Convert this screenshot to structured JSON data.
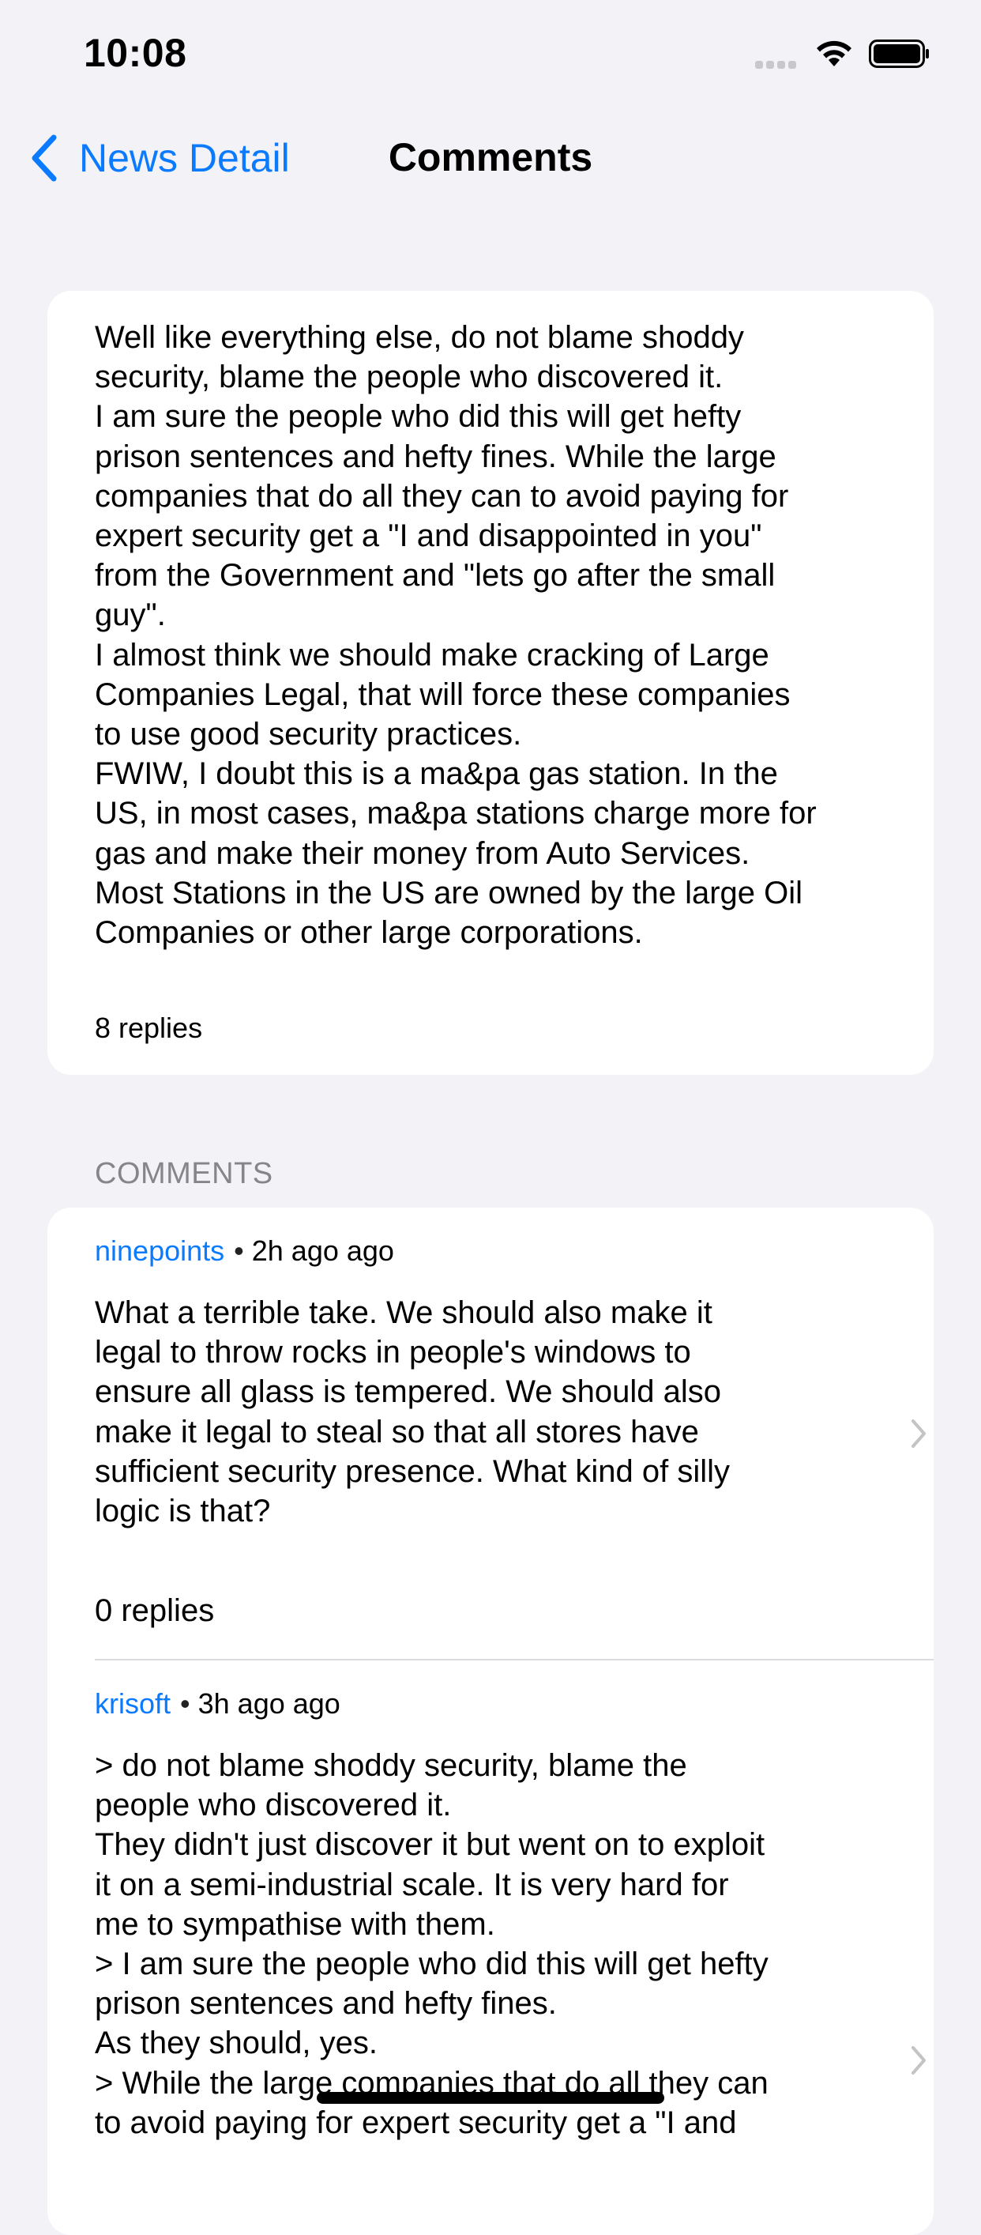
{
  "status_bar": {
    "time": "10:08"
  },
  "nav": {
    "back_label": "News Detail",
    "title": "Comments"
  },
  "main_comment": {
    "text": "Well like everything else, do not blame shoddy\nsecurity, blame the people who discovered it.\nI am sure the people who did this will get hefty\nprison sentences and hefty fines. While the large\ncompanies that do all they can to avoid paying for\nexpert security get a \"I and disappointed in you\"\nfrom the Government and \"lets go after the small\nguy\".\nI almost think we should make cracking of Large\nCompanies Legal, that will force these companies\nto use good security practices.\nFWIW, I doubt this is a ma&pa gas station. In the\nUS, in most cases, ma&pa stations charge more for\ngas and make their money from Auto Services.\nMost Stations in the US are owned by the large Oil\nCompanies or other large corporations.",
    "replies": "8 replies"
  },
  "section_header": "COMMENTS",
  "comments": [
    {
      "author": "ninepoints",
      "separator": "•",
      "time": "2h ago ago",
      "body": "What a terrible take. We should also make it\nlegal to throw rocks in people's windows to\nensure all glass is tempered. We should also\nmake it legal to steal so that all stores have\nsufficient security presence. What kind of silly\nlogic is that?",
      "replies": "0 replies"
    },
    {
      "author": "krisoft",
      "separator": "•",
      "time": "3h ago ago",
      "body": "> do not blame shoddy security, blame the\npeople who discovered it.\nThey didn't just discover it but went on to exploit\nit on a semi-industrial scale. It is very hard for\nme to sympathise with them.\n> I am sure the people who did this will get hefty\nprison sentences and hefty fines.\nAs they should, yes.\n> While the large companies that do all they can\nto avoid paying for expert security get a \"I and"
    }
  ],
  "colors": {
    "accent": "#0a7aff",
    "background": "#f2f2f7",
    "secondary_text": "#85858a"
  }
}
